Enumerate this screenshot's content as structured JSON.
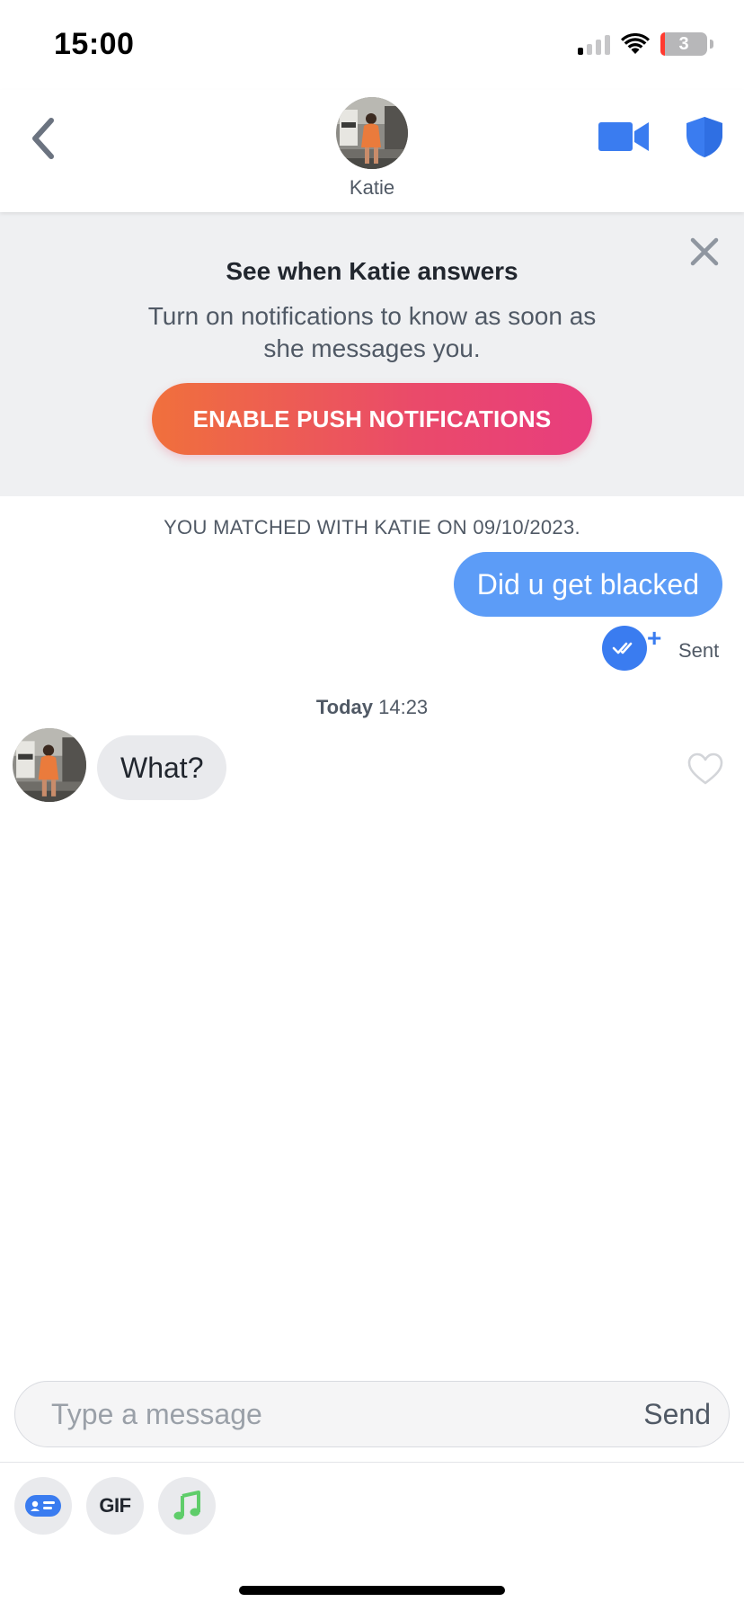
{
  "status_bar": {
    "time": "15:00",
    "battery_level": "3"
  },
  "header": {
    "contact_name": "Katie"
  },
  "notification_banner": {
    "title": "See when Katie answers",
    "body": "Turn on notifications to know as soon as she messages you.",
    "button_label": "ENABLE PUSH NOTIFICATIONS"
  },
  "chat": {
    "matched_text": "YOU MATCHED WITH KATIE ON 09/10/2023.",
    "messages": [
      {
        "direction": "outgoing",
        "text": "Did u get blacked",
        "status": "Sent"
      },
      {
        "direction": "incoming",
        "text": "What?"
      }
    ],
    "timestamp": {
      "day": "Today",
      "time": "14:23"
    }
  },
  "composer": {
    "placeholder": "Type a message",
    "send_label": "Send"
  },
  "tools": {
    "gif_label": "GIF"
  },
  "colors": {
    "accent_blue": "#5c9cf7",
    "check_blue": "#3a7cf0",
    "gradient_start": "#f0703c",
    "gradient_end": "#e83d7e"
  }
}
